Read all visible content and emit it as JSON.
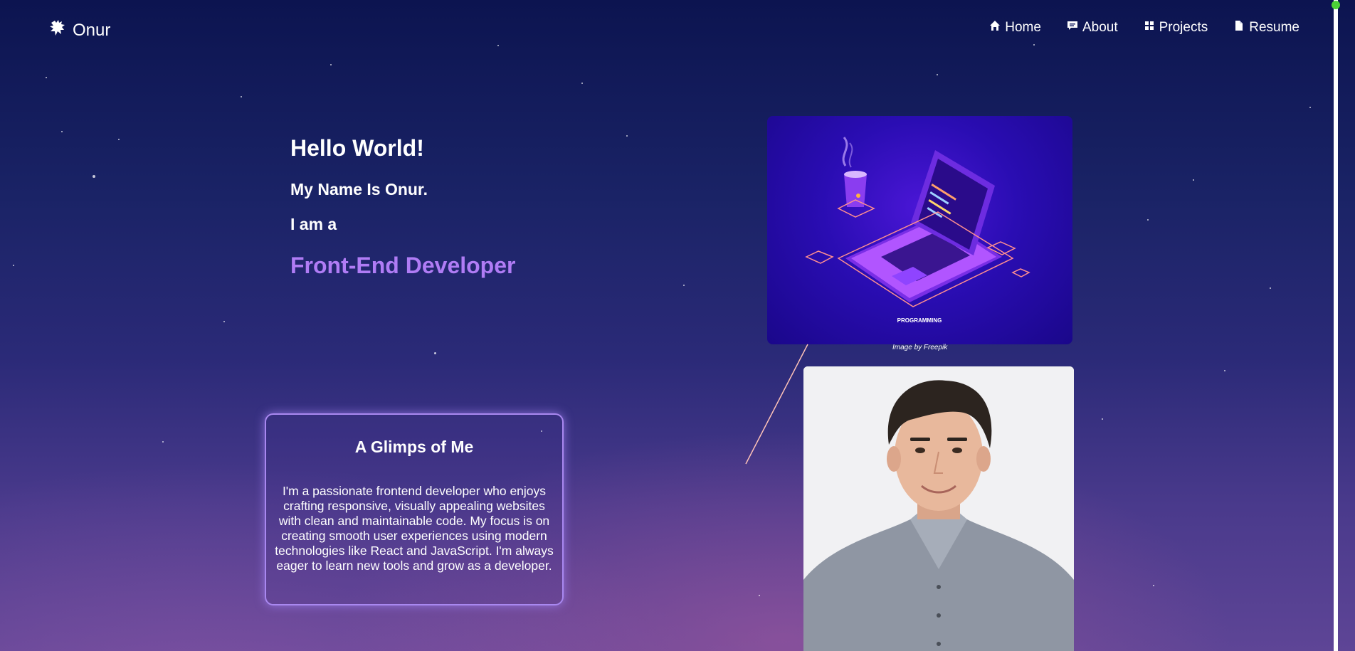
{
  "nav": {
    "brand": "Onur",
    "brand_icon": "lion-icon",
    "links": [
      {
        "label": "Home",
        "icon": "home-icon"
      },
      {
        "label": "About",
        "icon": "message-icon"
      },
      {
        "label": "Projects",
        "icon": "grid-icon"
      },
      {
        "label": "Resume",
        "icon": "document-icon"
      }
    ]
  },
  "hero": {
    "greeting": "Hello World!",
    "name_line": "My Name Is Onur.",
    "iam": "I am a",
    "role": "Front-End Developer"
  },
  "illustration": {
    "label": "PROGRAMMING",
    "credit": "Image by Freepik"
  },
  "about": {
    "title": "A Glimps of Me",
    "body": "I'm a passionate frontend developer who enjoys crafting responsive, visually appealing websites with clean and maintainable code. My focus is on creating smooth user experiences using modern technologies like React and JavaScript. I'm always eager to learn new tools and grow as a developer."
  },
  "colors": {
    "accent": "#b07cf5",
    "card_border": "#a988f0",
    "scroll_dot": "#4cd137"
  }
}
